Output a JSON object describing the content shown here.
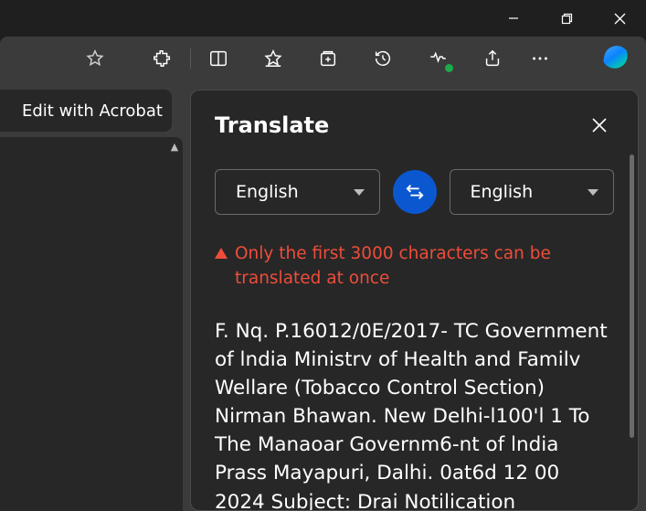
{
  "window": {
    "minimize_name": "minimize",
    "restore_name": "restore",
    "close_name": "close"
  },
  "toolbar": {
    "star": "favorite-icon",
    "extensions": "extensions-icon",
    "split": "split-screen-icon",
    "favorites": "favorites-icon",
    "collections": "collections-icon",
    "history": "history-icon",
    "performance": "performance-icon",
    "share": "share-icon",
    "more": "more-icon",
    "copilot": "copilot-icon"
  },
  "left": {
    "edit_label": "Edit with Acrobat"
  },
  "panel": {
    "title": "Translate",
    "close_name": "close",
    "source_lang": "English",
    "target_lang": "English",
    "swap_name": "swap-languages",
    "warning": "Only the first 3000 characters can be translated at once",
    "body": "F. Nq. P.16012/0E/2017- TC Government of lndia Ministrv of Health and Familv Wellare (Tobacco Control Section) Nirman Bhawan. New Delhi-l100'l 1 To The Manaoar Governm6-nt of lndia Prass Mayapuri, Dalhi. 0at6d 12 00 2024 Subject: Drai Notilication"
  }
}
